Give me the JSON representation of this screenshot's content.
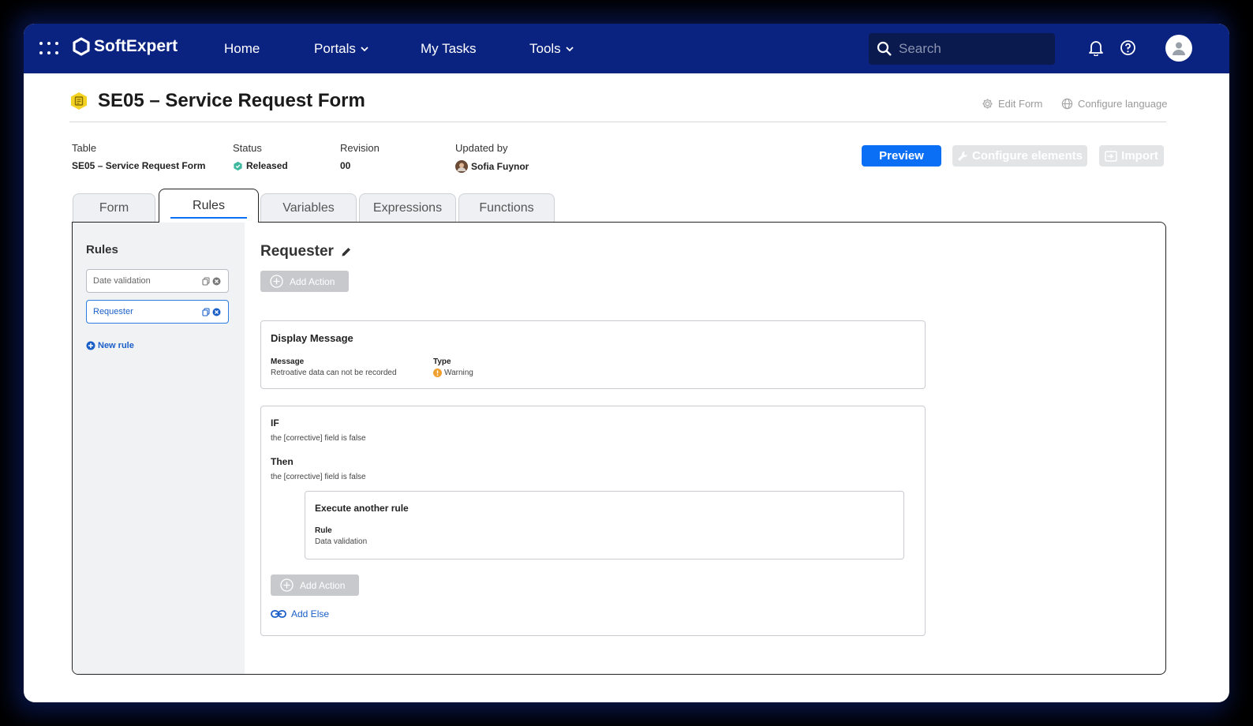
{
  "app": {
    "logo_text": "SoftExpert"
  },
  "nav": {
    "home": "Home",
    "portals": "Portals",
    "my_tasks": "My Tasks",
    "tools": "Tools"
  },
  "search": {
    "placeholder": "Search"
  },
  "page": {
    "title": "SE05 – Service Request Form",
    "edit_form": "Edit Form",
    "configure_language": "Configure language"
  },
  "meta": {
    "table_label": "Table",
    "table_value": "SE05 – Service Request Form",
    "status_label": "Status",
    "status_value": "Released",
    "revision_label": "Revision",
    "revision_value": "00",
    "updated_by_label": "Updated by",
    "updated_by_value": "Sofia Fuynor"
  },
  "actions": {
    "preview": "Preview",
    "configure_elements": "Configure elements",
    "import": "Import"
  },
  "tabs": [
    {
      "label": "Form"
    },
    {
      "label": "Rules"
    },
    {
      "label": "Variables"
    },
    {
      "label": "Expressions"
    },
    {
      "label": "Functions"
    }
  ],
  "sidebar": {
    "title": "Rules",
    "items": [
      {
        "label": "Date validation"
      },
      {
        "label": "Requester"
      }
    ],
    "new_rule": "New rule"
  },
  "main": {
    "title": "Requester",
    "add_action": "Add Action",
    "display_message": {
      "title": "Display Message",
      "message_label": "Message",
      "message_value": "Retroative data can not be recorded",
      "type_label": "Type",
      "type_value": "Warning"
    },
    "condition": {
      "if_label": "IF",
      "if_text": "the [corrective] field is false",
      "then_label": "Then",
      "then_text": "the [corrective] field is false",
      "nested": {
        "title": "Execute another rule",
        "rule_label": "Rule",
        "rule_value": "Data validation"
      },
      "add_action": "Add Action",
      "add_else": "Add Else"
    }
  },
  "colors": {
    "topbar": "#0b2380",
    "primary": "#0b6ff5",
    "link": "#1a5fc7",
    "status_released": "#3fb8a0",
    "warning": "#f0a030",
    "disabled": "#e3e4e6"
  }
}
